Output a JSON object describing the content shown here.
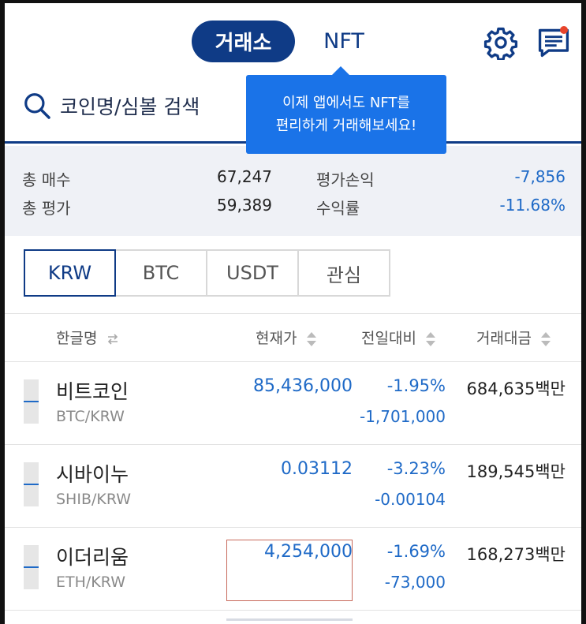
{
  "header": {
    "tab_exchange": "거래소",
    "tab_nft": "NFT",
    "settings_icon": "gear-icon",
    "notice_icon": "chat-notice-icon",
    "notice_dot_color": "#e8442b"
  },
  "search": {
    "placeholder": "코인명/심볼 검색"
  },
  "tooltip": {
    "line1": "이제 앱에서도 NFT를",
    "line2": "편리하게 거래해보세요!"
  },
  "summary": {
    "total_buy_label": "총 매수",
    "total_buy_value": "67,247",
    "total_eval_label": "총 평가",
    "total_eval_value": "59,389",
    "pnl_label": "평가손익",
    "pnl_value": "-7,856",
    "yield_label": "수익률",
    "yield_value": "-11.68%"
  },
  "currency_tabs": [
    "KRW",
    "BTC",
    "USDT",
    "관심"
  ],
  "active_tab": "KRW",
  "table_header": {
    "name": "한글명",
    "price": "현재가",
    "change": "전일대비",
    "volume": "거래대금"
  },
  "rows": [
    {
      "name": "비트코인",
      "symbol": "BTC/KRW",
      "price": "85,436,000",
      "rate": "-1.95%",
      "diff": "-1,701,000",
      "volume": "684,635백만"
    },
    {
      "name": "시바이누",
      "symbol": "SHIB/KRW",
      "price": "0.03112",
      "rate": "-3.23%",
      "diff": "-0.00104",
      "volume": "189,545백만"
    },
    {
      "name": "이더리움",
      "symbol": "ETH/KRW",
      "price": "4,254,000",
      "rate": "-1.69%",
      "diff": "-73,000",
      "volume": "168,273백만"
    }
  ],
  "colors": {
    "brand_navy": "#0f3b86",
    "tooltip_blue": "#1a73e8",
    "negative_blue": "#1f6ac7"
  }
}
